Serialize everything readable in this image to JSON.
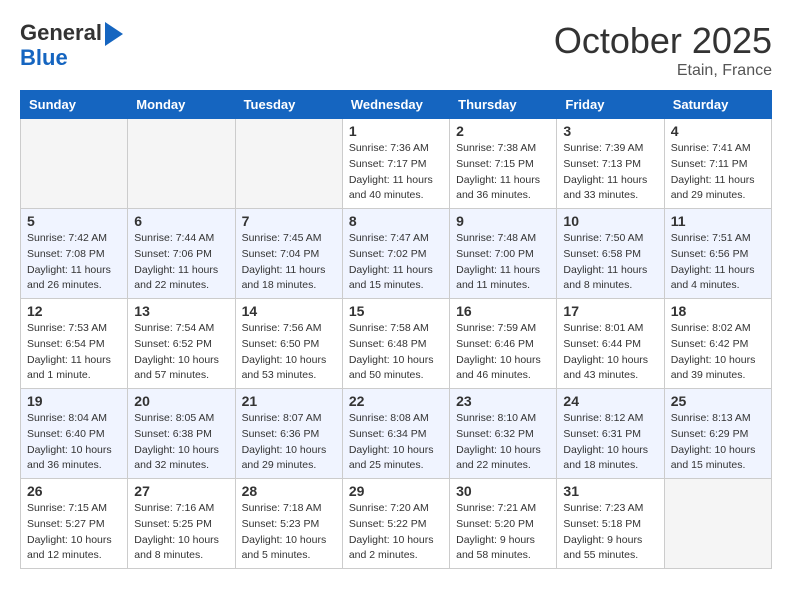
{
  "header": {
    "logo_line1": "General",
    "logo_line2": "Blue",
    "month_title": "October 2025",
    "location": "Etain, France"
  },
  "days_of_week": [
    "Sunday",
    "Monday",
    "Tuesday",
    "Wednesday",
    "Thursday",
    "Friday",
    "Saturday"
  ],
  "weeks": [
    [
      {
        "day": "",
        "info": ""
      },
      {
        "day": "",
        "info": ""
      },
      {
        "day": "",
        "info": ""
      },
      {
        "day": "1",
        "info": "Sunrise: 7:36 AM\nSunset: 7:17 PM\nDaylight: 11 hours\nand 40 minutes."
      },
      {
        "day": "2",
        "info": "Sunrise: 7:38 AM\nSunset: 7:15 PM\nDaylight: 11 hours\nand 36 minutes."
      },
      {
        "day": "3",
        "info": "Sunrise: 7:39 AM\nSunset: 7:13 PM\nDaylight: 11 hours\nand 33 minutes."
      },
      {
        "day": "4",
        "info": "Sunrise: 7:41 AM\nSunset: 7:11 PM\nDaylight: 11 hours\nand 29 minutes."
      }
    ],
    [
      {
        "day": "5",
        "info": "Sunrise: 7:42 AM\nSunset: 7:08 PM\nDaylight: 11 hours\nand 26 minutes."
      },
      {
        "day": "6",
        "info": "Sunrise: 7:44 AM\nSunset: 7:06 PM\nDaylight: 11 hours\nand 22 minutes."
      },
      {
        "day": "7",
        "info": "Sunrise: 7:45 AM\nSunset: 7:04 PM\nDaylight: 11 hours\nand 18 minutes."
      },
      {
        "day": "8",
        "info": "Sunrise: 7:47 AM\nSunset: 7:02 PM\nDaylight: 11 hours\nand 15 minutes."
      },
      {
        "day": "9",
        "info": "Sunrise: 7:48 AM\nSunset: 7:00 PM\nDaylight: 11 hours\nand 11 minutes."
      },
      {
        "day": "10",
        "info": "Sunrise: 7:50 AM\nSunset: 6:58 PM\nDaylight: 11 hours\nand 8 minutes."
      },
      {
        "day": "11",
        "info": "Sunrise: 7:51 AM\nSunset: 6:56 PM\nDaylight: 11 hours\nand 4 minutes."
      }
    ],
    [
      {
        "day": "12",
        "info": "Sunrise: 7:53 AM\nSunset: 6:54 PM\nDaylight: 11 hours\nand 1 minute."
      },
      {
        "day": "13",
        "info": "Sunrise: 7:54 AM\nSunset: 6:52 PM\nDaylight: 10 hours\nand 57 minutes."
      },
      {
        "day": "14",
        "info": "Sunrise: 7:56 AM\nSunset: 6:50 PM\nDaylight: 10 hours\nand 53 minutes."
      },
      {
        "day": "15",
        "info": "Sunrise: 7:58 AM\nSunset: 6:48 PM\nDaylight: 10 hours\nand 50 minutes."
      },
      {
        "day": "16",
        "info": "Sunrise: 7:59 AM\nSunset: 6:46 PM\nDaylight: 10 hours\nand 46 minutes."
      },
      {
        "day": "17",
        "info": "Sunrise: 8:01 AM\nSunset: 6:44 PM\nDaylight: 10 hours\nand 43 minutes."
      },
      {
        "day": "18",
        "info": "Sunrise: 8:02 AM\nSunset: 6:42 PM\nDaylight: 10 hours\nand 39 minutes."
      }
    ],
    [
      {
        "day": "19",
        "info": "Sunrise: 8:04 AM\nSunset: 6:40 PM\nDaylight: 10 hours\nand 36 minutes."
      },
      {
        "day": "20",
        "info": "Sunrise: 8:05 AM\nSunset: 6:38 PM\nDaylight: 10 hours\nand 32 minutes."
      },
      {
        "day": "21",
        "info": "Sunrise: 8:07 AM\nSunset: 6:36 PM\nDaylight: 10 hours\nand 29 minutes."
      },
      {
        "day": "22",
        "info": "Sunrise: 8:08 AM\nSunset: 6:34 PM\nDaylight: 10 hours\nand 25 minutes."
      },
      {
        "day": "23",
        "info": "Sunrise: 8:10 AM\nSunset: 6:32 PM\nDaylight: 10 hours\nand 22 minutes."
      },
      {
        "day": "24",
        "info": "Sunrise: 8:12 AM\nSunset: 6:31 PM\nDaylight: 10 hours\nand 18 minutes."
      },
      {
        "day": "25",
        "info": "Sunrise: 8:13 AM\nSunset: 6:29 PM\nDaylight: 10 hours\nand 15 minutes."
      }
    ],
    [
      {
        "day": "26",
        "info": "Sunrise: 7:15 AM\nSunset: 5:27 PM\nDaylight: 10 hours\nand 12 minutes."
      },
      {
        "day": "27",
        "info": "Sunrise: 7:16 AM\nSunset: 5:25 PM\nDaylight: 10 hours\nand 8 minutes."
      },
      {
        "day": "28",
        "info": "Sunrise: 7:18 AM\nSunset: 5:23 PM\nDaylight: 10 hours\nand 5 minutes."
      },
      {
        "day": "29",
        "info": "Sunrise: 7:20 AM\nSunset: 5:22 PM\nDaylight: 10 hours\nand 2 minutes."
      },
      {
        "day": "30",
        "info": "Sunrise: 7:21 AM\nSunset: 5:20 PM\nDaylight: 9 hours\nand 58 minutes."
      },
      {
        "day": "31",
        "info": "Sunrise: 7:23 AM\nSunset: 5:18 PM\nDaylight: 9 hours\nand 55 minutes."
      },
      {
        "day": "",
        "info": ""
      }
    ]
  ]
}
